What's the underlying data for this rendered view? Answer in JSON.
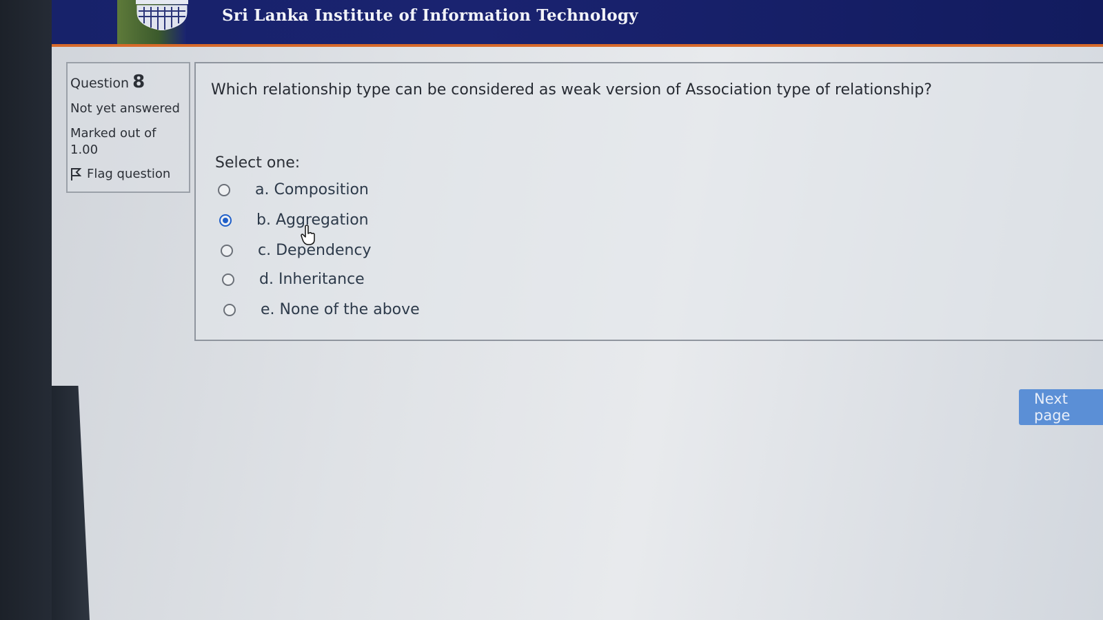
{
  "header": {
    "site_title": "Sri Lanka Institute of Information Technology",
    "logo_icon": "institute-crest-icon"
  },
  "question_info": {
    "label": "Question",
    "number": "8",
    "status": "Not yet answered",
    "marked_out_of_label": "Marked out of",
    "marked_out_of_value": "1.00",
    "flag_label": "Flag question",
    "flag_icon": "flag-icon"
  },
  "question": {
    "text": "Which relationship type can be considered as weak version of Association type of relationship?",
    "select_prompt": "Select one:",
    "options": [
      {
        "label": "a. Composition",
        "selected": false
      },
      {
        "label": "b.  Aggregation",
        "selected": true
      },
      {
        "label": "c. Dependency",
        "selected": false
      },
      {
        "label": "d. Inheritance",
        "selected": false
      },
      {
        "label": "e. None of the above",
        "selected": false
      }
    ]
  },
  "navigation": {
    "next_label": "Next page"
  },
  "colors": {
    "header_bg": "#17226a",
    "accent": "#d86a2a",
    "radio_selected": "#1f5fc9",
    "button_bg": "#5b8fd6"
  }
}
